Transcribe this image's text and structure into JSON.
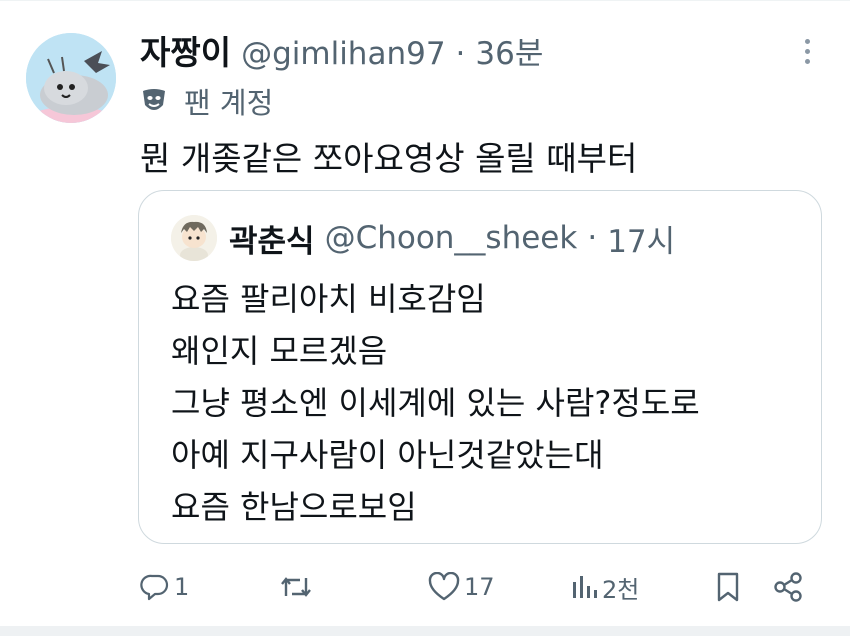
{
  "tweet": {
    "name": "자짱이",
    "handle": "@gimlihan97",
    "separator": "·",
    "time": "36분",
    "badge_label": "팬 계정",
    "text": "뭔 개좆같은 쪼아요영상 올릴 때부터"
  },
  "quote": {
    "name": "곽춘식",
    "handle": "@Choon__sheek",
    "separator": "·",
    "time": "17시",
    "lines": [
      "요즘 팔리아치 비호감임",
      "왜인지 모르겠음",
      "그냥 평소엔 이세계에 있는 사람?정도로",
      "아예 지구사람이 아닌것같았는대",
      "요즘 한남으로보임"
    ]
  },
  "actions": {
    "reply_count": "1",
    "retweet_count": "",
    "like_count": "17",
    "views_count": "2천"
  },
  "colors": {
    "text_primary": "#0f1419",
    "text_secondary": "#536471",
    "border": "#cfd9de"
  }
}
